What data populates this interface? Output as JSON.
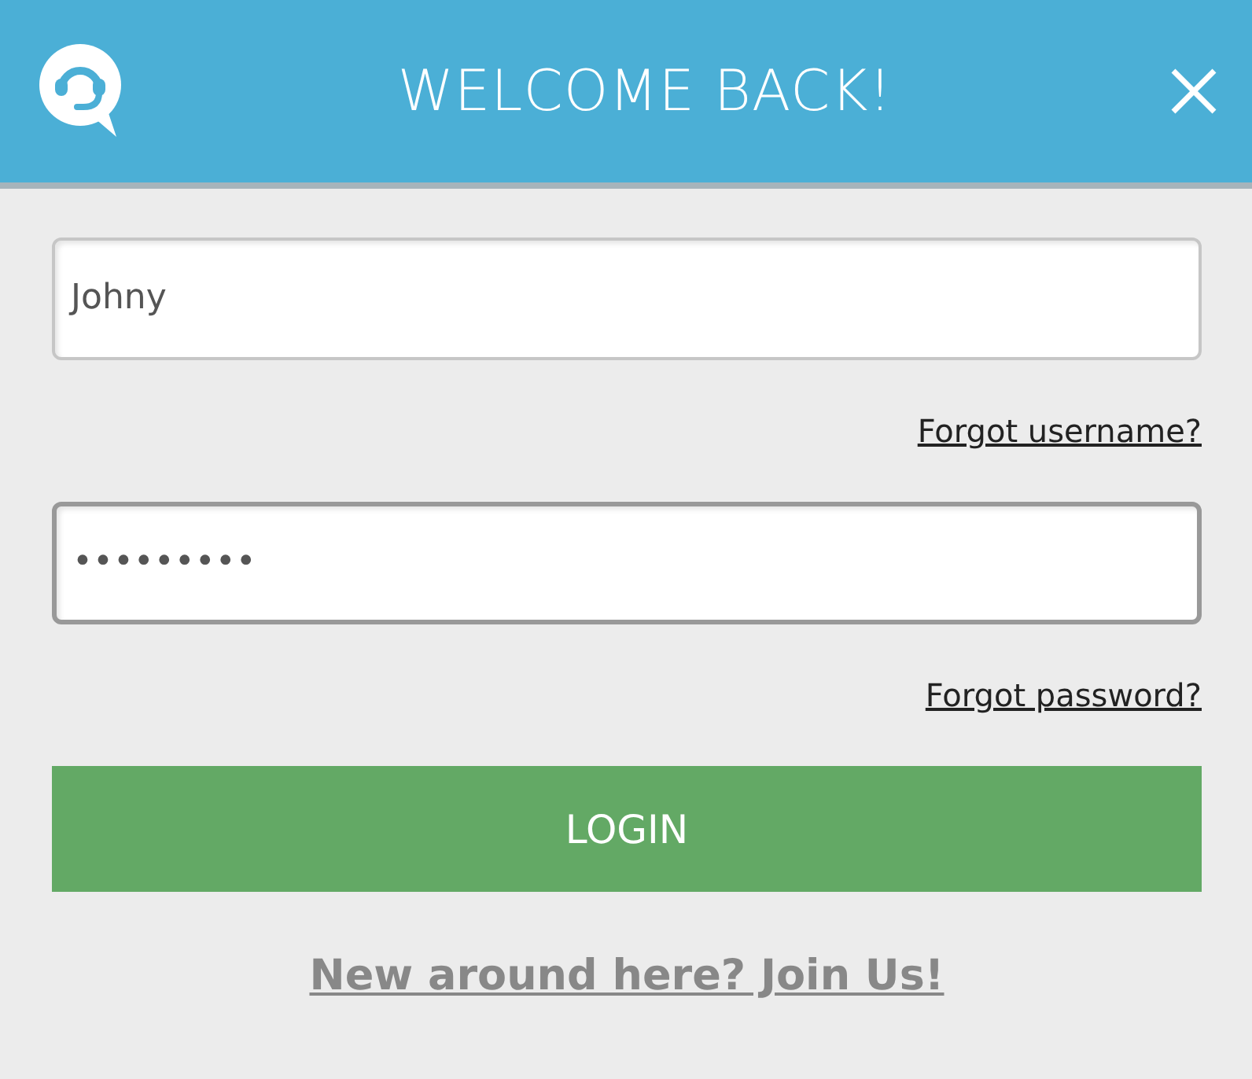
{
  "header": {
    "title": "WELCOME BACK!"
  },
  "fields": [
    {
      "value": "Johny",
      "focused": false,
      "link": "Forgot username?"
    },
    {
      "value": "•••••••••",
      "focused": true,
      "link": "Forgot password?"
    }
  ],
  "login_button": "LOGIN",
  "signup_link": "New around here? Join Us!"
}
